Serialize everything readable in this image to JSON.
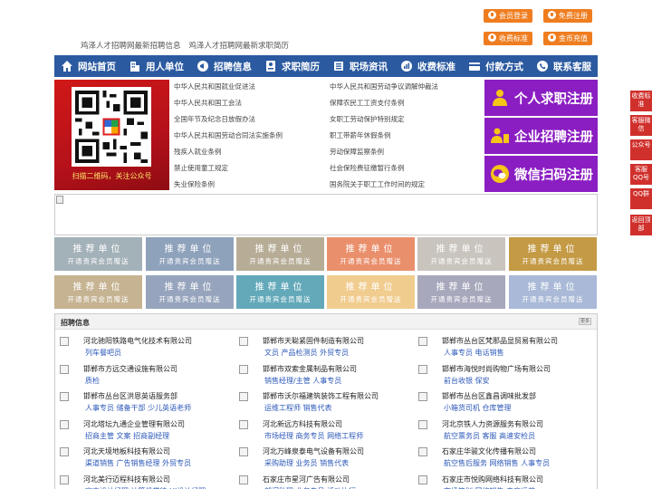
{
  "taglines": [
    "鸡泽人才招聘网最新招聘信息",
    "鸡泽人才招聘网最新求职简历"
  ],
  "top_buttons": [
    {
      "id": "member-login",
      "label": "会员登录"
    },
    {
      "id": "free-register",
      "label": "免费注册"
    },
    {
      "id": "fee-standard",
      "label": "收费标准"
    },
    {
      "id": "gold-recharge",
      "label": "金币充值"
    }
  ],
  "nav": [
    {
      "label": "网站首页",
      "icon": "home-icon"
    },
    {
      "label": "用人单位",
      "icon": "building-icon"
    },
    {
      "label": "招聘信息",
      "icon": "megaphone-icon"
    },
    {
      "label": "求职简历",
      "icon": "resume-icon"
    },
    {
      "label": "职场资讯",
      "icon": "news-icon"
    },
    {
      "label": "收费标准",
      "icon": "chart-icon"
    },
    {
      "label": "付款方式",
      "icon": "card-icon"
    },
    {
      "label": "联系客服",
      "icon": "phone-icon"
    }
  ],
  "qr_caption": "扫描二维码，关注公众号",
  "laws": [
    [
      "中华人民共和国就业促进法",
      "中华人民共和国劳动争议调解仲裁法"
    ],
    [
      "中华人民共和国工会法",
      "保障农民工工资支付条例"
    ],
    [
      "全国年节及纪念日放假办法",
      "女职工劳动保护特别规定"
    ],
    [
      "中华人民共和国劳动合同法实施条例",
      "职工带薪年休假条例"
    ],
    [
      "残疾人就业条例",
      "劳动保障监察条例"
    ],
    [
      "禁止使用童工规定",
      "社会保险费征缴暂行条例"
    ],
    [
      "失业保险条例",
      "国务院关于职工工作时间的规定"
    ]
  ],
  "register_buttons": [
    {
      "label": "个人求职注册",
      "icon": "person-icon"
    },
    {
      "label": "企业招聘注册",
      "icon": "company-icon"
    },
    {
      "label": "微信扫码注册",
      "icon": "wechat-icon"
    }
  ],
  "float_bar": [
    "收费标准",
    "客服微信",
    "公众号",
    "客服QQ号",
    "QQ群",
    "返回顶部"
  ],
  "recommend_tile": {
    "line1": "推荐单位",
    "line2": "开通贵宾会员赠送"
  },
  "recommend_colors": [
    "#a3b1b8",
    "#8fa2bb",
    "#b7ad97",
    "#ea8f6c",
    "#c9c4bd",
    "#c49a45",
    "#c6b392",
    "#97a4bd",
    "#63a9b9",
    "#f0cc8f",
    "#a7a8bc",
    "#a9b9d7"
  ],
  "jobs_title": "招聘信息",
  "jobs_more": "更多",
  "jobs": [
    {
      "company": "河北驰阳铁路电气化技术有限公司",
      "positions": "列车餐吧员"
    },
    {
      "company": "邯郸市天聪紧固件制造有限公司",
      "positions": "文员 产品检测员 外贸专员"
    },
    {
      "company": "邯郸市丛台区梵那品显贸易有限公司",
      "positions": "人事专员 电话销售"
    },
    {
      "company": "邯郸市方远交通设施有限公司",
      "positions": "质检"
    },
    {
      "company": "邯郸市双索金属制品有限公司",
      "positions": "销售经理/主管 人事专员"
    },
    {
      "company": "邯郸市海悦时尚购物广场有限公司",
      "positions": "前台收银 保安"
    },
    {
      "company": "邯郸市丛台区洪恩英语服务部",
      "positions": "人事专员 储备干部 少儿英语老师"
    },
    {
      "company": "邯郸市沃尔福建筑装饰工程有限公司",
      "positions": "运维工程师 销售代表"
    },
    {
      "company": "邯郸市丛台区鑫昌调味批发部",
      "positions": "小箱货司机 仓库管理"
    },
    {
      "company": "河北塔坛九通企业管理有限公司",
      "positions": "招商主管 文案 招商副经理"
    },
    {
      "company": "河北新远方科技有限公司",
      "positions": "市场经理 商务专员 网络工程师"
    },
    {
      "company": "河北京铁人力资源服务有限公司",
      "positions": "航空票务员 客服 高速安检员"
    },
    {
      "company": "河北天境地板科技有限公司",
      "positions": "渠道销售 广告销售经理 外贸专员"
    },
    {
      "company": "河北万峰泉泰电气设备有限公司",
      "positions": "采购助理 业务员 销售代表"
    },
    {
      "company": "石家庄华骏文化传播有限公司",
      "positions": "航空售后服务 网络销售 人事专员"
    },
    {
      "company": "河北美行迈程科技有限公司",
      "positions": "室内设计经理 计算机学徒 UI设计经理"
    },
    {
      "company": "石家庄市星河广告有限公司",
      "positions": "部门助理 业务专员 活动执行"
    },
    {
      "company": "石家庄市悦购网络科技有限公司",
      "positions": "市场策划 网络销售 电商运营"
    }
  ]
}
